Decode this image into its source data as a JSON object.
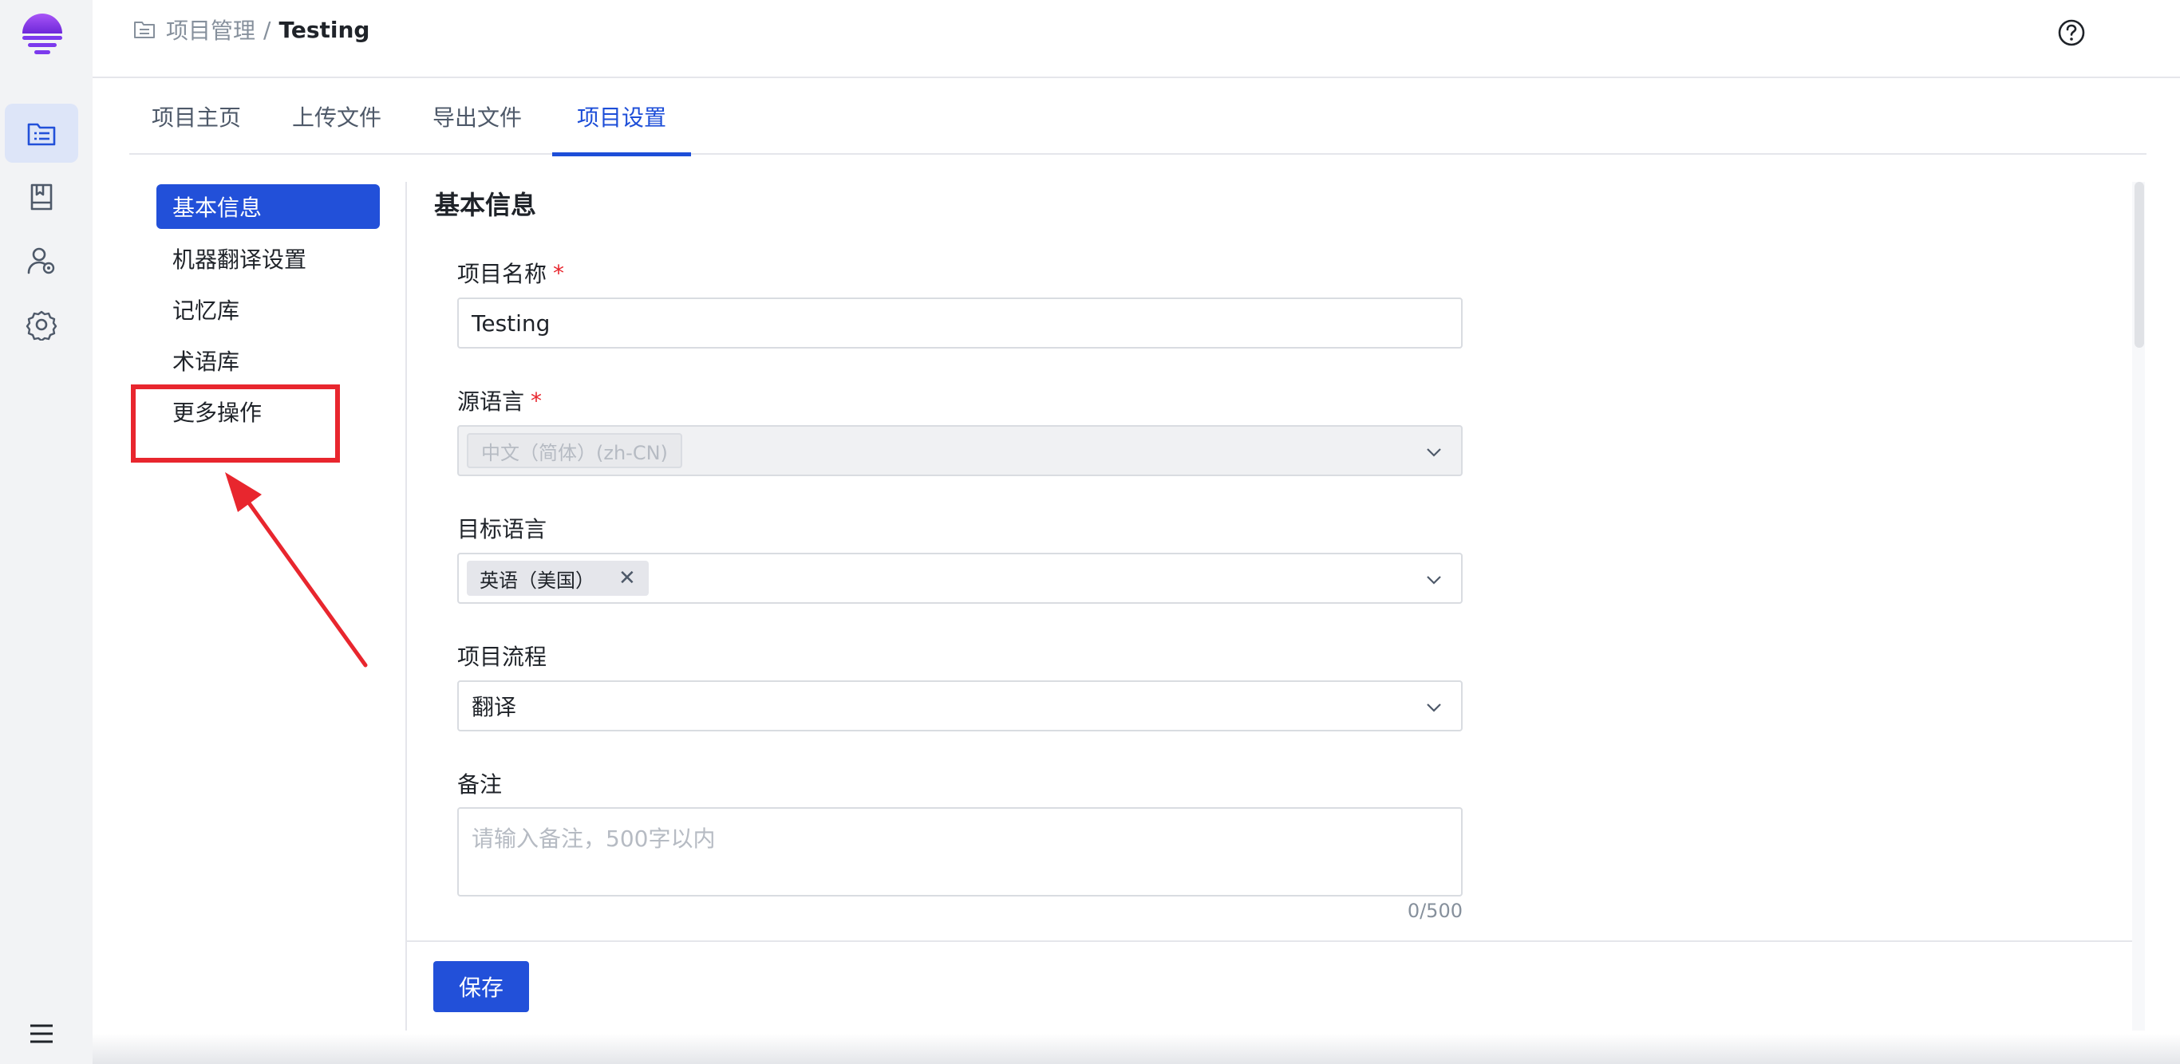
{
  "rail": {
    "items": [
      {
        "name": "project-list-icon",
        "active": true
      },
      {
        "name": "book-icon",
        "active": false
      },
      {
        "name": "user-settings-icon",
        "active": false
      },
      {
        "name": "gear-icon",
        "active": false
      }
    ],
    "menu_icon": "hamburger-icon"
  },
  "header": {
    "breadcrumb_parent": "项目管理",
    "breadcrumb_sep": "/",
    "breadcrumb_current": "Testing",
    "help_icon": "help-circle-icon"
  },
  "tabs": [
    "项目主页",
    "上传文件",
    "导出文件",
    "项目设置"
  ],
  "active_tab": "项目设置",
  "submenu": [
    "基本信息",
    "机器翻译设置",
    "记忆库",
    "术语库",
    "更多操作"
  ],
  "active_submenu": "基本信息",
  "form": {
    "title": "基本信息",
    "required_mark": "*",
    "name_label": "项目名称",
    "name_value": "Testing",
    "source_label": "源语言",
    "source_value": "中文（简体）(zh-CN)",
    "target_label": "目标语言",
    "target_value": "英语（美国）",
    "target_close": "✕",
    "flow_label": "项目流程",
    "flow_value": "翻译",
    "notes_label": "备注",
    "notes_placeholder": "请输入备注，500字以内",
    "notes_count": "0/500",
    "save_label": "保存"
  },
  "colors": {
    "accent": "#2250d9",
    "annotation": "#e8262e",
    "rail_bg": "#f2f3f5"
  }
}
